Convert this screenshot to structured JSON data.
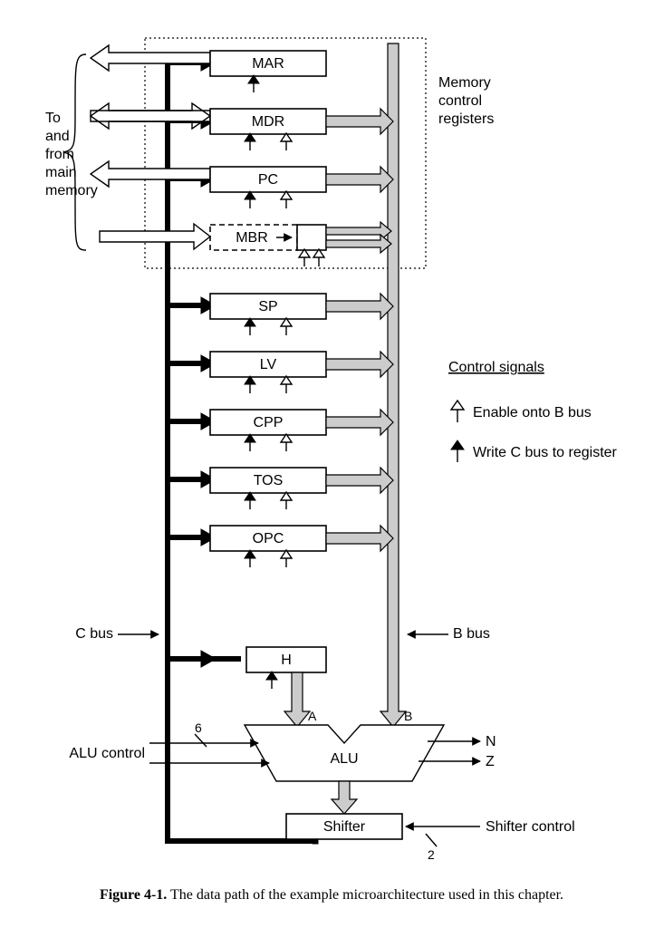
{
  "registers": {
    "mar": "MAR",
    "mdr": "MDR",
    "pc": "PC",
    "mbr": "MBR",
    "sp": "SP",
    "lv": "LV",
    "cpp": "CPP",
    "tos": "TOS",
    "opc": "OPC",
    "h": "H"
  },
  "units": {
    "alu": "ALU",
    "shifter": "Shifter"
  },
  "labels": {
    "memside1": "To",
    "memside2": "and",
    "memside3": "from",
    "memside4": "main",
    "memside5": "memory",
    "memctrl1": "Memory",
    "memctrl2": "control",
    "memctrl3": "registers",
    "cbus": "C bus",
    "bbus": "B bus",
    "aInput": "A",
    "bInput": "B",
    "aluctrl": "ALU control",
    "aluwidth": "6",
    "n": "N",
    "z": "Z",
    "shifterctrl": "Shifter control",
    "shifterwidth": "2",
    "legendTitle": "Control signals",
    "legendEnable": "Enable onto B bus",
    "legendWrite": "Write C bus to register"
  },
  "caption": {
    "bold": "Figure 4-1.",
    "rest": "  The data path of the example microarchitecture used in this chapter."
  }
}
